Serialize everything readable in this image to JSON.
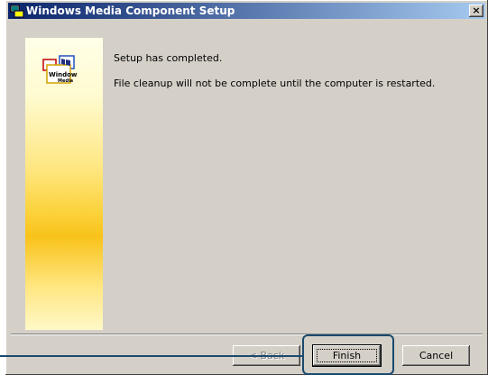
{
  "window": {
    "title": "Windows Media Component Setup",
    "close_glyph": "×"
  },
  "banner": {
    "logo_icon": "windows-media-logo",
    "logo_text": "Windows Media"
  },
  "messages": {
    "line1": "Setup has completed.",
    "line2": "File cleanup will not be complete until the computer is restarted."
  },
  "buttons": {
    "back_label": "< Back",
    "finish_label": "Finish",
    "cancel_label": "Cancel"
  },
  "colors": {
    "titlebar_start": "#0a246a",
    "titlebar_end": "#a6caf0",
    "dialog_bg": "#d4d0c8",
    "callout": "#1a4a6e"
  }
}
